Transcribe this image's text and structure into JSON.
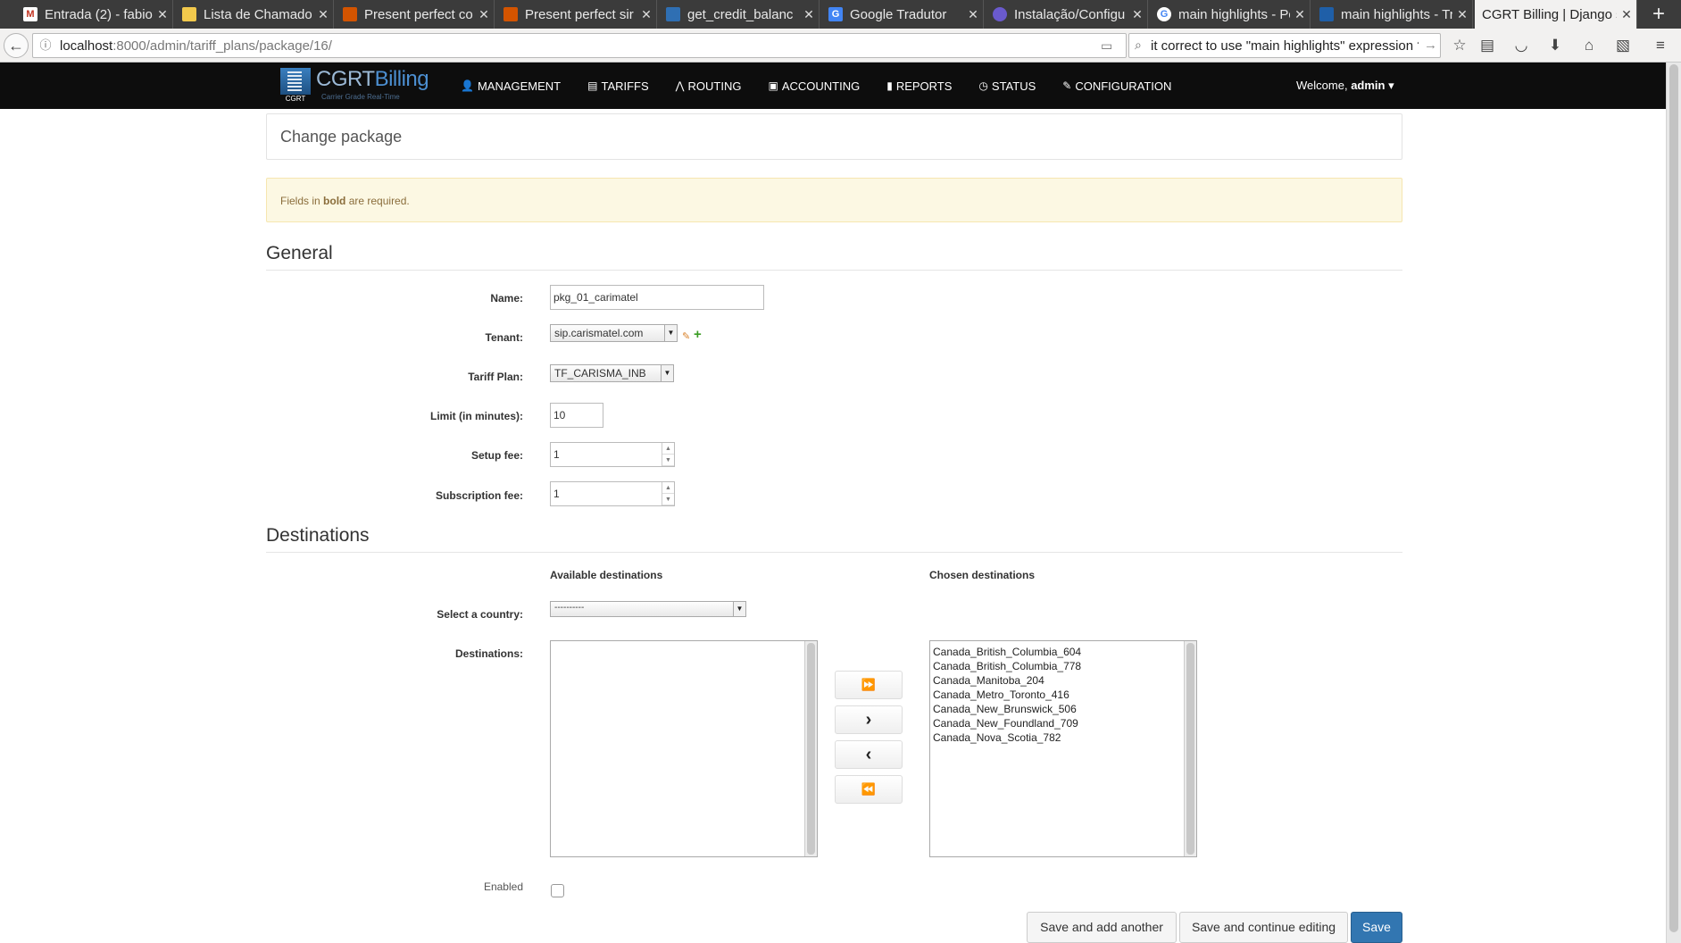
{
  "browser": {
    "tabs": [
      {
        "title": "Entrada (2) - fabio",
        "icon": "gmail-icon",
        "color": "#c23321"
      },
      {
        "title": "Lista de Chamado",
        "icon": "note-icon",
        "color": "#f2c94c"
      },
      {
        "title": "Present perfect co",
        "icon": "book-icon",
        "color": "#d35400"
      },
      {
        "title": "Present perfect sir",
        "icon": "book-icon",
        "color": "#d35400"
      },
      {
        "title": "get_credit_balanc",
        "icon": "doc-icon",
        "color": "#2f6fb3"
      },
      {
        "title": "Google Tradutor",
        "icon": "translate-icon",
        "color": "#4285f4"
      },
      {
        "title": "Instalação/Configu",
        "icon": "globe-icon",
        "color": "#6a5acd"
      },
      {
        "title": "main highlights - Pc",
        "icon": "google-icon",
        "color": "#ffffff"
      },
      {
        "title": "main highlights - Tr",
        "icon": "reverso-icon",
        "color": "#1f5fa8"
      },
      {
        "title": "CGRT Billing | Django s",
        "icon": "",
        "color": "",
        "active": true
      }
    ],
    "new_tab": "+",
    "url_host": "localhost",
    "url_rest": ":8000/admin/tariff_plans/package/16/",
    "search_query": "it correct to use \"main highlights\" expression ?"
  },
  "app": {
    "brand_name_1": "CGRT",
    "brand_name_2": "Billing",
    "brand_logo_text": "CGRT",
    "brand_tagline": "Carrier Grade Real-Time",
    "menu": [
      {
        "label": "MANAGEMENT",
        "icon": "user-icon",
        "glyph": "👤"
      },
      {
        "label": "TARIFFS",
        "icon": "list-icon",
        "glyph": "▤"
      },
      {
        "label": "ROUTING",
        "icon": "road-icon",
        "glyph": "⋀"
      },
      {
        "label": "ACCOUNTING",
        "icon": "briefcase-icon",
        "glyph": "▣"
      },
      {
        "label": "REPORTS",
        "icon": "bar-chart-icon",
        "glyph": "▮"
      },
      {
        "label": "STATUS",
        "icon": "clock-icon",
        "glyph": "◷"
      },
      {
        "label": "CONFIGURATION",
        "icon": "wrench-icon",
        "glyph": "✎"
      }
    ],
    "welcome_prefix": "Welcome,",
    "welcome_user": "admin"
  },
  "page": {
    "title": "Change package",
    "alert_pre": "Fields in",
    "alert_bold": "bold",
    "alert_post": "are required.",
    "sections": {
      "general": "General",
      "destinations": "Destinations"
    },
    "fields": {
      "name": {
        "label": "Name:",
        "value": "pkg_01_carimatel"
      },
      "tenant": {
        "label": "Tenant:",
        "value": "sip.carismatel.com"
      },
      "tariff_plan": {
        "label": "Tariff Plan:",
        "value": "TF_CARISMA_INB"
      },
      "limit": {
        "label": "Limit (in minutes):",
        "value": "10"
      },
      "setup_fee": {
        "label": "Setup fee:",
        "value": "1"
      },
      "subscription_fee": {
        "label": "Subscription fee:",
        "value": "1"
      }
    },
    "destinations": {
      "available_title": "Available destinations",
      "chosen_title": "Chosen destinations",
      "country_label": "Select a country:",
      "country_value": "----------",
      "destinations_label": "Destinations:",
      "available": [],
      "chosen": [
        "Canada_British_Columbia_604",
        "Canada_British_Columbia_778",
        "Canada_Manitoba_204",
        "Canada_Metro_Toronto_416",
        "Canada_New_Brunswick_506",
        "Canada_New_Foundland_709",
        "Canada_Nova_Scotia_782"
      ],
      "buttons": {
        "add_all": "⏩",
        "add": "›",
        "remove": "‹",
        "remove_all": "⏪"
      }
    },
    "enabled_label": "Enabled",
    "enabled": false,
    "actions": {
      "save_add_another": "Save and add another",
      "save_continue": "Save and continue editing",
      "save": "Save"
    }
  }
}
